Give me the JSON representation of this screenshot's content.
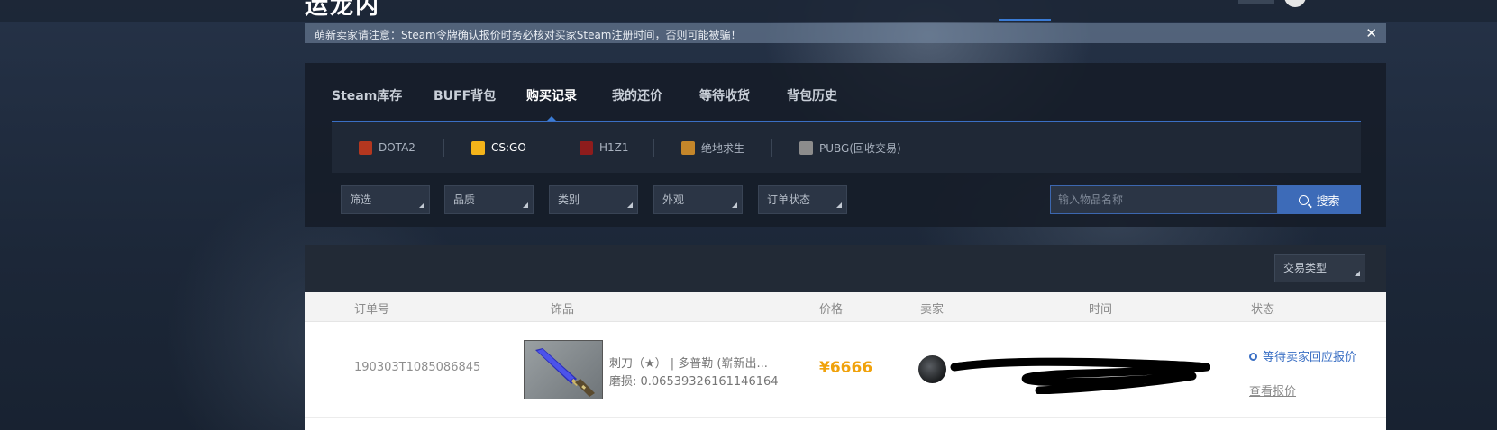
{
  "header": {
    "logo_fragment": "运龙内"
  },
  "notice": {
    "text": "萌新卖家请注意：Steam令牌确认报价时务必核对买家Steam注册时间，否则可能被骗！",
    "close": "✕"
  },
  "tabs": [
    {
      "label": "Steam库存"
    },
    {
      "label": "BUFF背包"
    },
    {
      "label": "购买记录",
      "active": true
    },
    {
      "label": "我的还价"
    },
    {
      "label": "等待收货"
    },
    {
      "label": "背包历史"
    }
  ],
  "games": [
    {
      "label": "DOTA2",
      "icon": "dota2-icon",
      "color": "#b4371f"
    },
    {
      "label": "CS:GO",
      "icon": "csgo-icon",
      "color": "#f4b41a",
      "active": true
    },
    {
      "label": "H1Z1",
      "icon": "h1z1-icon",
      "color": "#8e1c1c"
    },
    {
      "label": "绝地求生",
      "icon": "pubg-icon",
      "color": "#c4862a"
    },
    {
      "label": "PUBG(回收交易)",
      "icon": "pubg-recycle-icon",
      "color": "#8c8c8c"
    }
  ],
  "filters": [
    {
      "label": "筛选"
    },
    {
      "label": "品质"
    },
    {
      "label": "类别"
    },
    {
      "label": "外观"
    },
    {
      "label": "订单状态"
    }
  ],
  "search": {
    "placeholder": "输入物品名称",
    "button": "搜索"
  },
  "trade_type": {
    "label": "交易类型"
  },
  "table": {
    "headers": [
      "订单号",
      "饰品",
      "价格",
      "卖家",
      "时间",
      "状态"
    ],
    "rows": [
      {
        "order_no": "190303T1085086845",
        "item_name": "刺刀（★） | 多普勒 (崭新出...",
        "wear": "磨损: 0.06539326161146164",
        "price": "¥6666",
        "status": "等待卖家回应报价",
        "action": "查看报价"
      }
    ]
  },
  "colors": {
    "accent": "#3a6fc4",
    "price": "#f0a20c"
  }
}
